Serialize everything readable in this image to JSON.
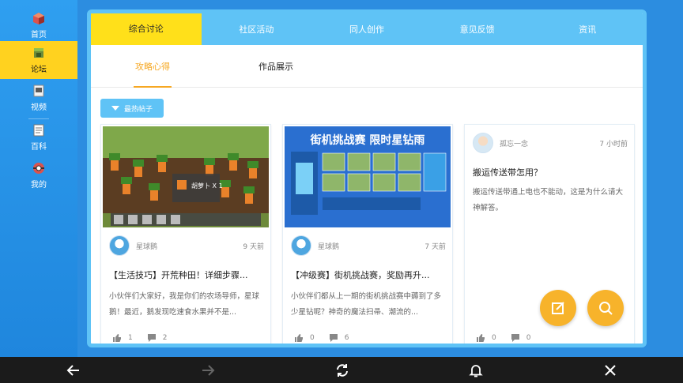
{
  "sidebar": {
    "items": [
      {
        "label": "首页",
        "icon": "home-icon"
      },
      {
        "label": "论坛",
        "icon": "forum-icon"
      },
      {
        "label": "视频",
        "icon": "video-icon"
      },
      {
        "label": "百科",
        "icon": "wiki-icon"
      },
      {
        "label": "我的",
        "icon": "profile-icon"
      }
    ],
    "active_index": 1
  },
  "tabs": [
    {
      "label": "综合讨论"
    },
    {
      "label": "社区活动"
    },
    {
      "label": "同人创作"
    },
    {
      "label": "意见反馈"
    },
    {
      "label": "资讯"
    }
  ],
  "subtabs": [
    {
      "label": "攻略心得"
    },
    {
      "label": "作品展示"
    }
  ],
  "sort_button": {
    "label": "最热帖子"
  },
  "posts": [
    {
      "author": "星球鹅",
      "time": "9 天前",
      "title": "【生活技巧】开荒种田！详细步骤...",
      "body": "小伙伴们大家好，我是你们的农场导师，星球鹅！最近，鹅发现吃速食水果并不是...",
      "likes": "1",
      "comments": "2"
    },
    {
      "author": "星球鹅",
      "time": "7 天前",
      "title": "【冲级赛】街机挑战赛，奖励再升...",
      "body": "小伙伴们都从上一期的街机挑战赛中薅到了多少星钻呢？神奇的魔法扫帚、潮流的...",
      "likes": "0",
      "comments": "6",
      "banner_title": "街机挑战赛 限时星钻雨"
    },
    {
      "author": "孤忘一念",
      "time": "7 小时前",
      "title": "搬运传送带怎用？",
      "body": "搬运传送带通上电也不能动，这是为什么请大神解答。",
      "likes": "0",
      "comments": "0"
    }
  ],
  "game_hotbar_tooltip": "胡萝卜 X 1",
  "colors": {
    "accent_yellow": "#ffe01a",
    "tab_blue": "#5fc3f6",
    "subtab_active": "#f6a823",
    "fab_orange": "#f7b32b",
    "sidebar_blue": "#2f9ff0"
  },
  "fabs": [
    {
      "icon": "edit-icon"
    },
    {
      "icon": "search-icon"
    }
  ],
  "system_bar": [
    {
      "icon": "back-arrow-icon"
    },
    {
      "icon": "forward-arrow-icon"
    },
    {
      "icon": "refresh-icon"
    },
    {
      "icon": "bell-icon"
    },
    {
      "icon": "close-icon"
    }
  ]
}
